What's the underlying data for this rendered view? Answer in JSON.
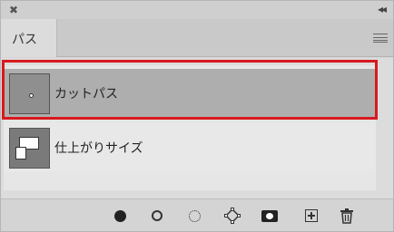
{
  "titlebar": {
    "close_glyph": "✖",
    "collapse_glyph": "◂◂"
  },
  "tab": {
    "label": "パス"
  },
  "paths": [
    {
      "label": "カットパス",
      "selected": true,
      "icon": "dot-path-thumbnail"
    },
    {
      "label": "仕上がりサイズ",
      "selected": false,
      "icon": "shape-path-thumbnail"
    }
  ],
  "highlight_color": "#d7191f",
  "toolbar": [
    {
      "name": "fill-path-icon"
    },
    {
      "name": "stroke-path-icon"
    },
    {
      "name": "load-as-selection-icon"
    },
    {
      "name": "make-work-path-icon"
    },
    {
      "name": "add-mask-icon"
    },
    {
      "name": "new-path-icon"
    },
    {
      "name": "delete-path-icon"
    }
  ]
}
